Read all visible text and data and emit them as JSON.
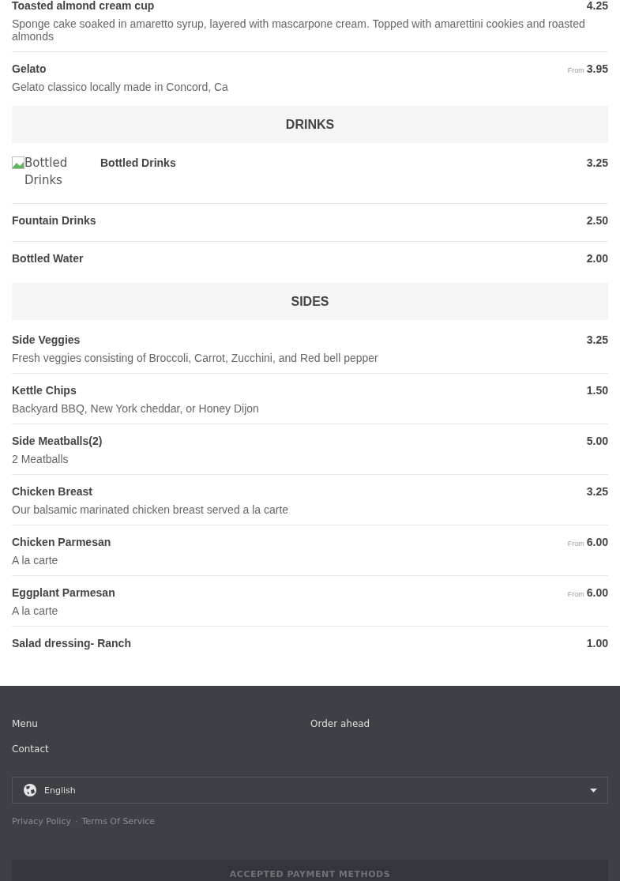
{
  "sections": [
    {
      "items": [
        {
          "name": "Toasted almond cream cup",
          "price": "4.25",
          "description": "Sponge cake soaked in amaretto syrup, layered with mascarpone cream. Topped with amarettini cookies and roasted almonds"
        },
        {
          "name": "Gelato",
          "price_prefix": "From",
          "price": "3.95",
          "description": "Gelato classico locally made in Concord, Ca"
        }
      ]
    },
    {
      "title": "DRINKS",
      "items": [
        {
          "name": "Bottled Drinks",
          "price": "3.25",
          "image_alt": "Bottled Drinks"
        },
        {
          "name": "Fountain Drinks",
          "price": "2.50"
        },
        {
          "name": "Bottled Water",
          "price": "2.00"
        }
      ]
    },
    {
      "title": "SIDES",
      "items": [
        {
          "name": "Side Veggies",
          "price": "3.25",
          "description": "Fresh veggies consisting of Broccoli, Carrot, Zucchini, and Red bell pepper"
        },
        {
          "name": "Kettle Chips",
          "price": "1.50",
          "description": "Backyard BBQ, New York cheddar, or Honey Dijon"
        },
        {
          "name": "Side Meatballs(2)",
          "price": "5.00",
          "description": "2 Meatballs"
        },
        {
          "name": "Chicken Breast",
          "price": "3.25",
          "description": "Our balsamic marinated chicken breast served a la carte"
        },
        {
          "name": "Chicken Parmesan",
          "price_prefix": "From",
          "price": "6.00",
          "description": "A la carte"
        },
        {
          "name": "Eggplant Parmesan",
          "price_prefix": "From",
          "price": "6.00",
          "description": "A la carte"
        },
        {
          "name": "Salad dressing- Ranch",
          "price": "1.00"
        }
      ]
    }
  ],
  "footer": {
    "links_left": [
      "Menu",
      "Contact"
    ],
    "links_right": [
      "Order ahead"
    ],
    "language_select": {
      "value": "English"
    },
    "legal_links": [
      "Privacy Policy",
      "Terms Of Service"
    ],
    "legal_separator": "·",
    "payment_heading": "ACCEPTED PAYMENT METHODS"
  }
}
